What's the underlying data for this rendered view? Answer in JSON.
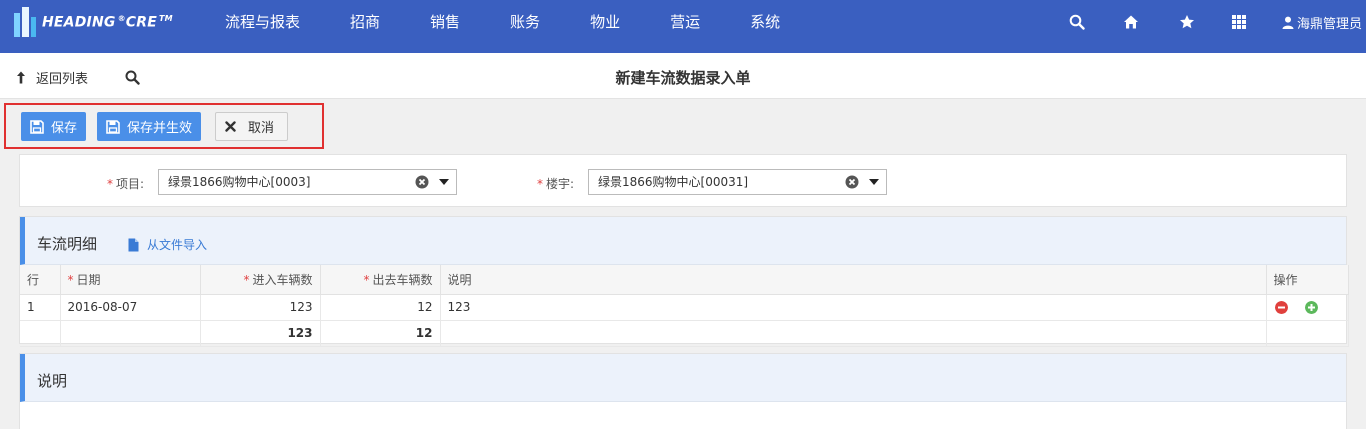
{
  "app": {
    "logo_text": "HEADING",
    "logo_reg": "®",
    "logo_text2": "CRE",
    "logo_tm": "TM"
  },
  "menu": [
    "流程与报表",
    "招商",
    "销售",
    "账务",
    "物业",
    "营运",
    "系统"
  ],
  "nav_icons": [
    "search-icon",
    "home-icon",
    "star-icon",
    "grid-icon"
  ],
  "user": {
    "name": "海鼎管理员"
  },
  "subheader": {
    "back_label": "返回列表",
    "title": "新建车流数据录入单"
  },
  "toolbar": {
    "save_label": "保存",
    "save_effect_label": "保存并生效",
    "cancel_label": "取消"
  },
  "form": {
    "project_label": "项目:",
    "project_value": "绿景1866购物中心[0003]",
    "building_label": "楼宇:",
    "building_value": "绿景1866购物中心[00031]"
  },
  "detail": {
    "title": "车流明细",
    "import_label": "从文件导入",
    "columns": [
      "行",
      "日期",
      "进入车辆数",
      "出去车辆数",
      "说明",
      "操作"
    ],
    "rows": [
      {
        "row": "1",
        "date": "2016-08-07",
        "in": "123",
        "out": "12",
        "note": "123"
      }
    ],
    "totals": {
      "in": "123",
      "out": "12"
    }
  },
  "desc": {
    "title": "说明"
  },
  "colors": {
    "nav_bg": "#3a5fc0",
    "primary": "#4a8fe8",
    "highlight": "#e03030",
    "remove": "#e0403d",
    "add": "#5cb85c"
  }
}
